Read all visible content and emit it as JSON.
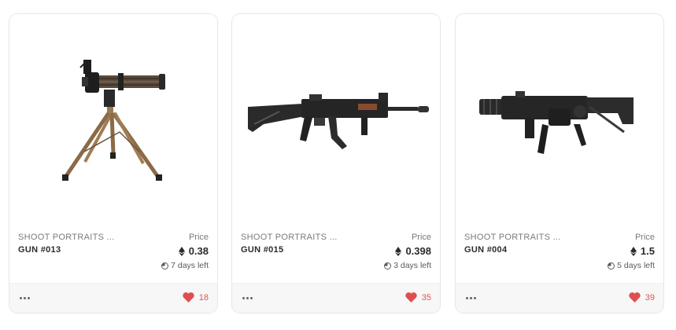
{
  "colors": {
    "heart": "#e04e4e",
    "like_count": "#e25555",
    "border": "#e6e6e6",
    "footer_bg": "#f7f7f7"
  },
  "cards": [
    {
      "image": "minigun-on-tripod",
      "collection": "SHOOT PORTRAITS ...",
      "name": "GUN #013",
      "price_label": "Price",
      "currency_icon": "ethereum-icon",
      "price": "0.38",
      "time_left": "7 days left",
      "more_icon": "more-dots-icon",
      "likes": "18"
    },
    {
      "image": "assault-rifle",
      "collection": "SHOOT PORTRAITS ...",
      "name": "GUN #015",
      "price_label": "Price",
      "currency_icon": "ethereum-icon",
      "price": "0.398",
      "time_left": "3 days left",
      "more_icon": "more-dots-icon",
      "likes": "35"
    },
    {
      "image": "heavy-gun",
      "collection": "SHOOT PORTRAITS ...",
      "name": "GUN #004",
      "price_label": "Price",
      "currency_icon": "ethereum-icon",
      "price": "1.5",
      "time_left": "5 days left",
      "more_icon": "more-dots-icon",
      "likes": "39"
    }
  ]
}
